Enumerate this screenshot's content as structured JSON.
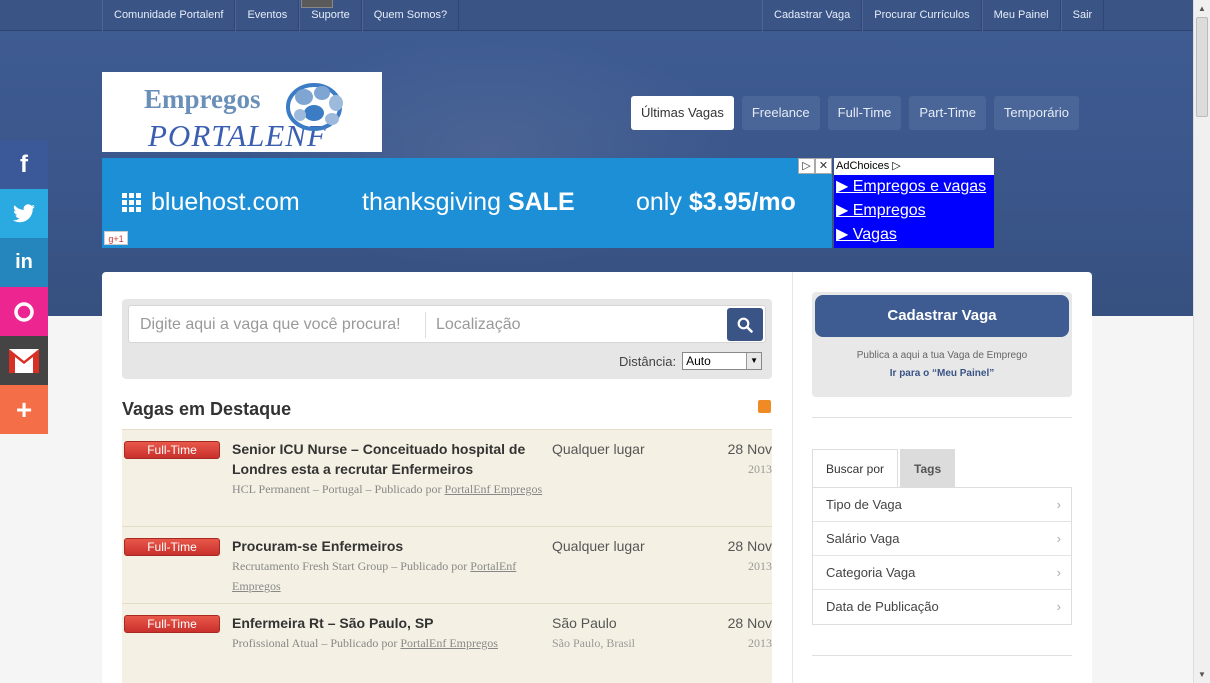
{
  "topnav": {
    "left": [
      "Comunidade Portalenf",
      "Eventos",
      "Suporte",
      "Quem Somos?"
    ],
    "right": [
      "Cadastrar Vaga",
      "Procurar Currículos",
      "Meu Painel",
      "Sair"
    ]
  },
  "logo": {
    "line1": "Empregos",
    "line2": "PORTALENF"
  },
  "tabs": [
    "Últimas Vagas",
    "Freelance",
    "Full-Time",
    "Part-Time",
    "Temporário"
  ],
  "ad": {
    "brand": "bluehost.com",
    "middle_a": "thanksgiving ",
    "middle_b": "SALE",
    "price_a": "only ",
    "price_b": "$3.95/mo",
    "gplus": "g+1",
    "adchoices": "AdChoices",
    "links": [
      "▶ Empregos e vagas",
      "▶ Empregos",
      "▶ Vagas"
    ]
  },
  "social": {
    "items": [
      {
        "name": "facebook",
        "glyph": "f",
        "color": "#3b5998"
      },
      {
        "name": "twitter",
        "glyph": "t",
        "color": "#2ba9e1"
      },
      {
        "name": "linkedin",
        "glyph": "in",
        "color": "#2585bd"
      },
      {
        "name": "orkut",
        "glyph": "O",
        "color": "#ed2590"
      },
      {
        "name": "gmail",
        "glyph": "M",
        "color": "#e8e8e8"
      },
      {
        "name": "more",
        "glyph": "+",
        "color": "#f46e47"
      }
    ]
  },
  "search": {
    "query_placeholder": "Digite aqui a vaga que você procura!",
    "location_placeholder": "Localização",
    "distance_label": "Distância:",
    "distance_value": "Auto"
  },
  "featured": {
    "title": "Vagas em Destaque",
    "jobs": [
      {
        "type": "Full-Time",
        "title": "Senior ICU Nurse – Conceituado hospital de Londres esta a recrutar Enfermeiros",
        "company": "HCL Permanent – Portugal – Publicado por ",
        "publisher": "PortalEnf Empregos",
        "location": "Qualquer lugar",
        "location2": "",
        "date": "28 Nov",
        "year": "2013"
      },
      {
        "type": "Full-Time",
        "title": "Procuram-se Enfermeiros",
        "company": "Recrutamento Fresh Start Group – Publicado por ",
        "publisher": "PortalEnf Empregos",
        "location": "Qualquer lugar",
        "location2": "",
        "date": "28 Nov",
        "year": "2013"
      },
      {
        "type": "Full-Time",
        "title": "Enfermeira Rt – São Paulo, SP",
        "company": "Profissional Atual – Publicado por ",
        "publisher": "PortalEnf Empregos",
        "location": "São Paulo",
        "location2": "São Paulo, Brasil",
        "date": "28 Nov",
        "year": "2013"
      }
    ]
  },
  "sidebar": {
    "cadastrar": "Cadastrar Vaga",
    "desc": "Publica a aqui a tua Vaga de Emprego",
    "link": "Ir para o “Meu Painel”",
    "tabs": [
      "Buscar por",
      "Tags"
    ],
    "filters": [
      "Tipo de Vaga",
      "Salário Vaga",
      "Categoria Vaga",
      "Data de Publicação"
    ]
  }
}
